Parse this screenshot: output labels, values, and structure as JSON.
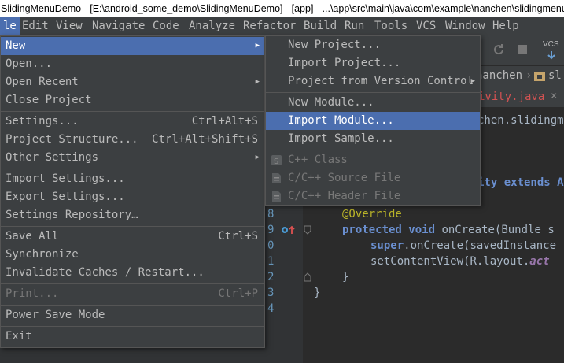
{
  "window": {
    "title": "SlidingMenuDemo - [E:\\android_some_demo\\SlidingMenuDemo] - [app] - ...\\app\\src\\main\\java\\com\\example\\nanchen\\slidingmenudemo"
  },
  "menubar": [
    "le",
    "Edit",
    "View",
    "Navigate",
    "Code",
    "Analyze",
    "Refactor",
    "Build",
    "Run",
    "Tools",
    "VCS",
    "Window",
    "Help"
  ],
  "file_menu": {
    "items": [
      {
        "label": "New",
        "shortcut": "",
        "submenu": true
      },
      {
        "label": "Open...",
        "shortcut": ""
      },
      {
        "label": "Open Recent",
        "shortcut": "",
        "submenu": true
      },
      {
        "label": "Close Project",
        "shortcut": ""
      },
      {
        "label": "Settings...",
        "shortcut": "Ctrl+Alt+S"
      },
      {
        "label": "Project Structure...",
        "shortcut": "Ctrl+Alt+Shift+S"
      },
      {
        "label": "Other Settings",
        "shortcut": "",
        "submenu": true
      },
      {
        "label": "Import Settings...",
        "shortcut": ""
      },
      {
        "label": "Export Settings...",
        "shortcut": ""
      },
      {
        "label": "Settings Repository…",
        "shortcut": ""
      },
      {
        "label": "Save All",
        "shortcut": "Ctrl+S"
      },
      {
        "label": "Synchronize",
        "shortcut": ""
      },
      {
        "label": "Invalidate Caches / Restart...",
        "shortcut": ""
      },
      {
        "label": "Print...",
        "shortcut": "Ctrl+P",
        "disabled": true
      },
      {
        "label": "Power Save Mode",
        "shortcut": ""
      },
      {
        "label": "Exit",
        "shortcut": ""
      }
    ]
  },
  "new_menu": {
    "items": [
      {
        "label": "New Project..."
      },
      {
        "label": "Import Project..."
      },
      {
        "label": "Project from Version Control",
        "submenu": true
      },
      {
        "label": "New Module..."
      },
      {
        "label": "Import Module..."
      },
      {
        "label": "Import Sample..."
      },
      {
        "label": "C++ Class",
        "disabled": true
      },
      {
        "label": "C/C++ Source File",
        "disabled": true
      },
      {
        "label": "C/C++ Header File",
        "disabled": true
      }
    ]
  },
  "toolbar": {
    "vcs_label": "VCS"
  },
  "breadcrumb": {
    "item1": "nanchen",
    "item2": "sl"
  },
  "editor_tab": {
    "label": "ivity.java"
  },
  "code": {
    "package_tail": "chen.slidingm",
    "extends_line": "ity extends Ap",
    "annotation": "@Override",
    "l_protected": "protected",
    "l_void": "void",
    "l_oncreate": "onCreate",
    "l_params": "(Bundle s",
    "l_super": "super",
    "l_super_rest": ".onCreate(savedInstance",
    "l_setcontent": "setContentView(",
    "l_r": "R.layout.",
    "l_act": "act",
    "close_inner": "}",
    "close_outer": "}"
  },
  "line_numbers": [
    "8",
    "9",
    "0",
    "1",
    "2",
    "3",
    "4"
  ]
}
